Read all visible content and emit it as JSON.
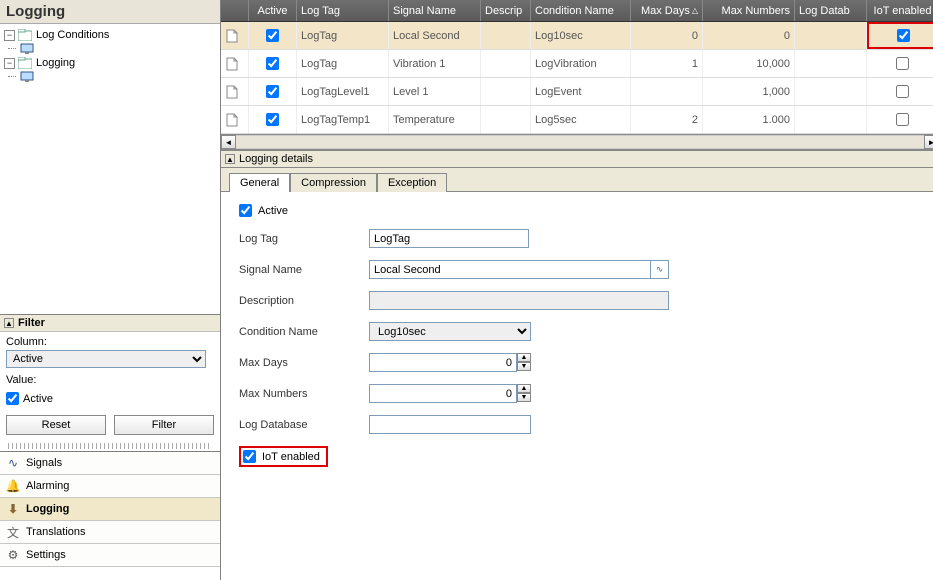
{
  "title": "Logging",
  "tree": {
    "root1": "Log Conditions",
    "root2": "Logging"
  },
  "filter": {
    "heading": "Filter",
    "column_label": "Column:",
    "column_value": "Active",
    "value_label": "Value:",
    "active_ck": "Active",
    "reset": "Reset",
    "filter_btn": "Filter"
  },
  "nav": {
    "signals": "Signals",
    "alarming": "Alarming",
    "logging": "Logging",
    "translations": "Translations",
    "settings": "Settings"
  },
  "grid": {
    "cols": {
      "active": "Active",
      "tag": "Log Tag",
      "sig": "Signal Name",
      "desc": "Descrip",
      "cond": "Condition Name",
      "days": "Max Days",
      "nums": "Max Numbers",
      "db": "Log Datab",
      "iot": "IoT enabled"
    },
    "rows": [
      {
        "active": true,
        "tag": "LogTag",
        "sig": "Local Second",
        "desc": "",
        "cond": "Log10sec",
        "days": "0",
        "nums": "0",
        "db": "",
        "iot": true
      },
      {
        "active": true,
        "tag": "LogTag",
        "sig": "Vibration 1",
        "desc": "",
        "cond": "LogVibration",
        "days": "1",
        "nums": "10,000",
        "db": "",
        "iot": false
      },
      {
        "active": true,
        "tag": "LogTagLevel1",
        "sig": "Level 1",
        "desc": "",
        "cond": "LogEvent",
        "days": "",
        "nums": "1,000",
        "db": "",
        "iot": false
      },
      {
        "active": true,
        "tag": "LogTagTemp1",
        "sig": "Temperature",
        "desc": "",
        "cond": "Log5sec",
        "days": "2",
        "nums": "1.000",
        "db": "",
        "iot": false
      }
    ]
  },
  "details": {
    "heading": "Logging details",
    "tabs": {
      "general": "General",
      "compression": "Compression",
      "exception": "Exception"
    },
    "form": {
      "active": "Active",
      "logtag_lbl": "Log Tag",
      "logtag_val": "LogTag",
      "sig_lbl": "Signal Name",
      "sig_val": "Local Second",
      "desc_lbl": "Description",
      "desc_val": "",
      "cond_lbl": "Condition Name",
      "cond_val": "Log10sec",
      "days_lbl": "Max Days",
      "days_val": "0",
      "nums_lbl": "Max Numbers",
      "nums_val": "0",
      "db_lbl": "Log Database",
      "db_val": "",
      "iot_lbl": "IoT enabled"
    }
  }
}
